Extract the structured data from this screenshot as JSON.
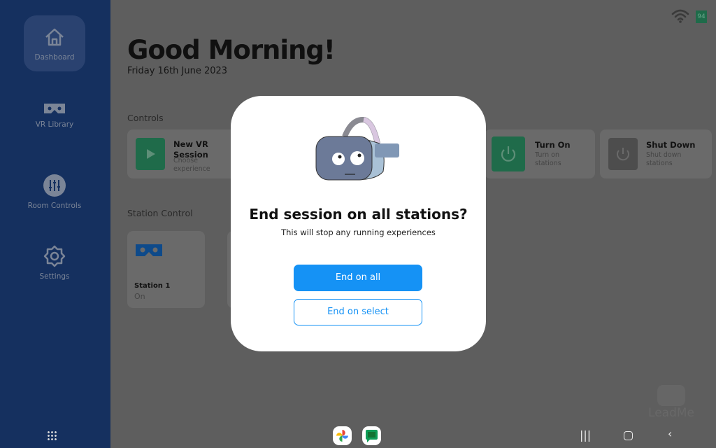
{
  "sidebar": {
    "items": [
      {
        "label": "Dashboard",
        "icon": "home-icon",
        "active": true
      },
      {
        "label": "VR Library",
        "icon": "vr-headset-icon"
      },
      {
        "label": "Room Controls",
        "icon": "sliders-icon"
      },
      {
        "label": "Settings",
        "icon": "gear-icon"
      }
    ]
  },
  "status": {
    "battery": "94"
  },
  "header": {
    "greeting": "Good Morning!",
    "date": "Friday 16th June 2023"
  },
  "controls": {
    "heading": "Controls",
    "cards": [
      {
        "title": "New VR Session",
        "subtitle": "Choose experience",
        "icon": "play-icon"
      },
      {
        "title": "Turn On",
        "subtitle": "Turn on stations",
        "icon": "power-icon"
      },
      {
        "title": "Shut Down",
        "subtitle": "Shut down stations",
        "icon": "power-icon"
      }
    ]
  },
  "stations": {
    "heading": "Station Control",
    "items": [
      {
        "name": "Station 1",
        "status": "On"
      }
    ]
  },
  "modal": {
    "title": "End session on all stations?",
    "subtitle": "This will stop any running experiences",
    "primary": "End on all",
    "secondary": "End on select"
  },
  "watermark": "LeadMe",
  "colors": {
    "sidebar": "#15305f",
    "accent": "#1592f5",
    "green": "#1f6b4a"
  }
}
